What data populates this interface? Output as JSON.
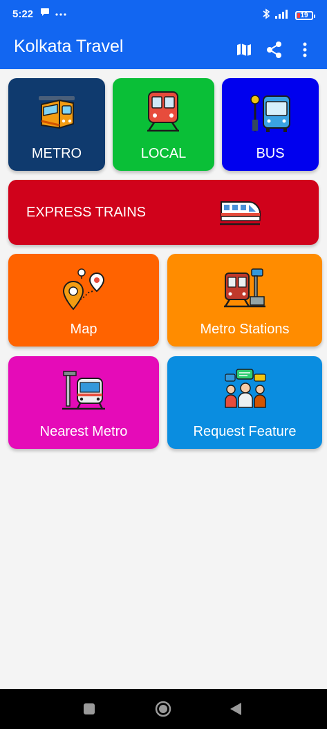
{
  "status": {
    "time": "5:22",
    "battery": "19"
  },
  "appbar": {
    "title": "Kolkata Travel"
  },
  "tiles": {
    "metro": {
      "label": "METRO",
      "color": "#0f3a6e"
    },
    "local": {
      "label": "LOCAL",
      "color": "#0abf37"
    },
    "bus": {
      "label": "BUS",
      "color": "#0000ee"
    },
    "express": {
      "label": "EXPRESS TRAINS",
      "color": "#d0021b"
    },
    "map": {
      "label": "Map",
      "color": "#ff6300"
    },
    "metro_stations": {
      "label": "Metro Stations",
      "color": "#ff8c00"
    },
    "nearest_metro": {
      "label": "Nearest Metro",
      "color": "#e50bb8"
    },
    "request_feature": {
      "label": "Request Feature",
      "color": "#0a8de0"
    }
  },
  "icons": {
    "metro": "metro-train-icon",
    "local": "local-train-icon",
    "bus": "bus-stop-icon",
    "express": "express-train-icon",
    "map": "map-pin-icon",
    "metro_stations": "station-icon",
    "nearest_metro": "nearest-metro-icon",
    "request_feature": "feedback-people-icon"
  }
}
